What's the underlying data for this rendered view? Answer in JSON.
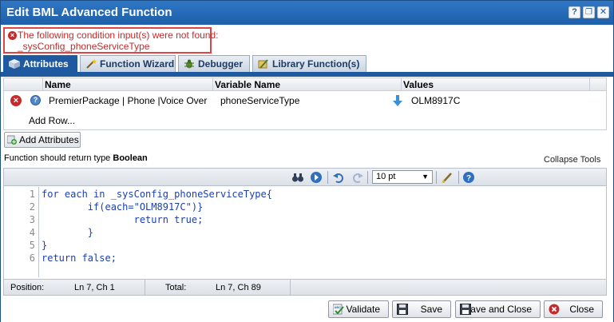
{
  "window": {
    "title": "Edit BML Advanced Function",
    "help_glyph": "?",
    "restore_glyph": "❐",
    "close_glyph": "✕"
  },
  "error": {
    "line1": "The following condition input(s) were not found:",
    "line2": "_sysConfig_phoneServiceType",
    "icon_glyph": "×"
  },
  "tabs": [
    {
      "label": "Attributes",
      "icon": "cube-icon",
      "active": true
    },
    {
      "label": "Function Wizard",
      "icon": "wand-icon",
      "active": false
    },
    {
      "label": "Debugger",
      "icon": "bug-icon",
      "active": false
    },
    {
      "label": "Library Function(s)",
      "icon": "library-icon",
      "active": false
    }
  ],
  "attributes_grid": {
    "columns": [
      "Name",
      "Variable Name",
      "Values"
    ],
    "rows": [
      {
        "name": "PremierPackage | Phone |Voice Over I...",
        "variable_name": "phoneServiceType",
        "value": "OLM8917C",
        "delete_glyph": "×",
        "info_glyph": "?"
      }
    ],
    "add_row_label": "Add Row..."
  },
  "add_attributes_label": "Add Attributes",
  "return_type": {
    "prefix": "Function should return type",
    "type": "Boolean"
  },
  "collapse_tools_label": "Collapse Tools",
  "editor": {
    "font_size_value": "10 pt",
    "font_size_caret": "▼",
    "line_numbers": [
      "1",
      "2",
      "3",
      "4",
      "5",
      "6"
    ],
    "lines": [
      "for each in _sysConfig_phoneServiceType{",
      "        if(each=\"OLM8917C\")}",
      "                return true;",
      "        }",
      "}",
      "return false;"
    ]
  },
  "status": {
    "position_label": "Position:",
    "position_value": "Ln 7, Ch 1",
    "total_label": "Total:",
    "total_value": "Ln 7, Ch 89"
  },
  "footer": {
    "validate_label": "Validate",
    "save_label": "Save",
    "save_close_label": "Save and Close",
    "close_label": "Close"
  },
  "colors": {
    "titlebar": "#1d5fa8",
    "error_red": "#c42b2b",
    "active_tab": "#1f5aa0",
    "code_blue": "#1a3fb0",
    "code_string": "#1f7fd0"
  }
}
